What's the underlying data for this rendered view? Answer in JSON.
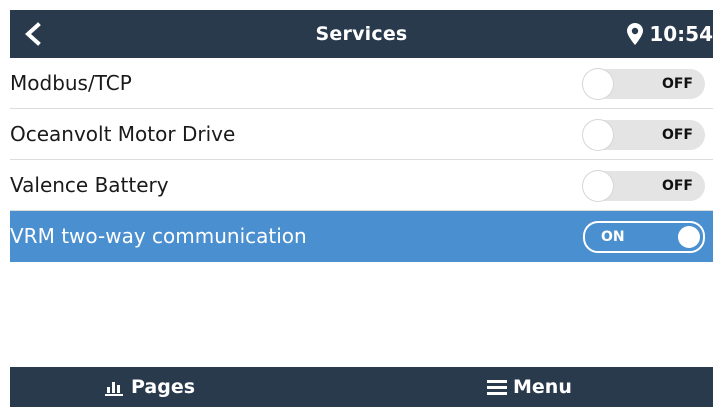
{
  "header": {
    "back_icon": "chevron-left-icon",
    "title": "Services",
    "location_icon": "map-pin-icon",
    "time": "10:54"
  },
  "services": [
    {
      "label": "Modbus/TCP",
      "state": "OFF",
      "enabled": false,
      "selected": false
    },
    {
      "label": "Oceanvolt Motor Drive",
      "state": "OFF",
      "enabled": false,
      "selected": false
    },
    {
      "label": "Valence Battery",
      "state": "OFF",
      "enabled": false,
      "selected": false
    },
    {
      "label": "VRM two-way communication",
      "state": "ON",
      "enabled": true,
      "selected": true
    }
  ],
  "footer": {
    "pages_icon": "bar-chart-icon",
    "pages_label": "Pages",
    "menu_icon": "hamburger-menu-icon",
    "menu_label": "Menu"
  },
  "colors": {
    "header_bg": "#2a3a4d",
    "selected_row_bg": "#4a8fd0",
    "toggle_off_bg": "#e4e4e4"
  }
}
